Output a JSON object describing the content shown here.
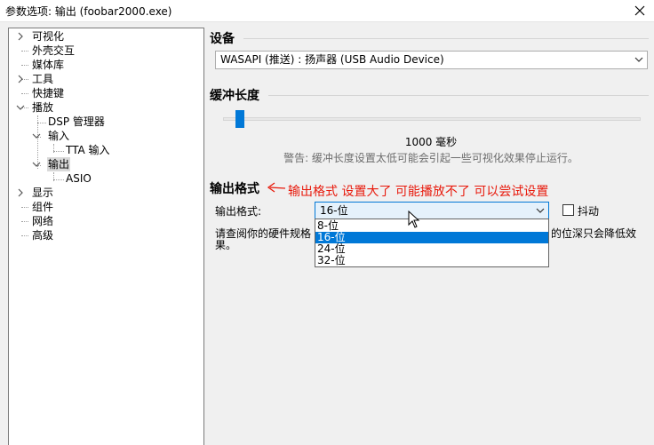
{
  "window": {
    "title": "参数选项: 输出 (foobar2000.exe)"
  },
  "tree": {
    "items": [
      {
        "label": "可视化"
      },
      {
        "label": "外壳交互"
      },
      {
        "label": "媒体库"
      },
      {
        "label": "工具"
      },
      {
        "label": "快捷键"
      },
      {
        "label": "播放"
      },
      {
        "label": "DSP 管理器"
      },
      {
        "label": "输入"
      },
      {
        "label": "TTA 输入"
      },
      {
        "label": "输出"
      },
      {
        "label": "ASIO"
      },
      {
        "label": "显示"
      },
      {
        "label": "组件"
      },
      {
        "label": "网络"
      },
      {
        "label": "高级"
      }
    ]
  },
  "device": {
    "group_title": "设备",
    "selected": "WASAPI (推送) : 扬声器 (USB Audio Device)"
  },
  "buffer": {
    "group_title": "缓冲长度",
    "value_label": "1000 毫秒",
    "slider_fraction": 0.04,
    "warning": "警告: 缓冲长度设置太低可能会引起一些可视化效果停止运行。"
  },
  "output_format": {
    "group_title": "输出格式",
    "annotation": "输出格式  设置大了  可能播放不了  可以尝试设置",
    "field_label": "输出格式:",
    "selected": "16-位",
    "dither_label": "抖动",
    "help_text_left": "请查阅你的硬件规格",
    "help_text_right": "的位深只会降低效",
    "help_text_line2": "果。",
    "options": [
      "8-位",
      "16-位",
      "24-位",
      "32-位"
    ]
  },
  "colors": {
    "accent": "#0078d7",
    "annotation": "#e8190b"
  }
}
